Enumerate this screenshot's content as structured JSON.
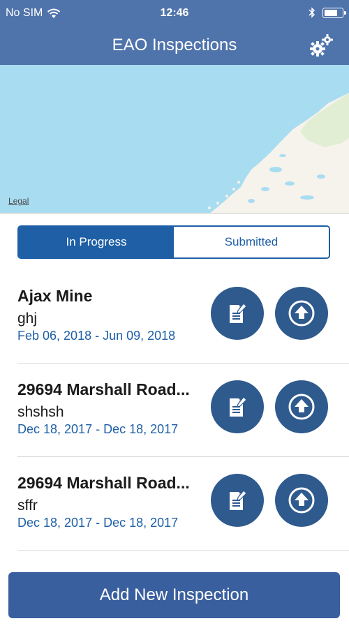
{
  "status_bar": {
    "carrier": "No SIM",
    "time": "12:46",
    "icons": [
      "wifi-icon",
      "bluetooth-icon",
      "battery-icon"
    ]
  },
  "nav": {
    "title": "EAO Inspections",
    "settings_icon": "gears-icon"
  },
  "map": {
    "legal_label": "Legal"
  },
  "tabs": [
    {
      "label": "In Progress",
      "selected": true
    },
    {
      "label": "Submitted",
      "selected": false
    }
  ],
  "inspections": [
    {
      "title": "Ajax Mine",
      "subtitle": "ghj",
      "dates": "Feb 06, 2018 - Jun 09, 2018"
    },
    {
      "title": "29694 Marshall Road...",
      "subtitle": "shshsh",
      "dates": "Dec 18, 2017 - Dec 18, 2017"
    },
    {
      "title": "29694 Marshall Road...",
      "subtitle": "sffr",
      "dates": "Dec 18, 2017 - Dec 18, 2017"
    }
  ],
  "add_button": {
    "label": "Add New Inspection"
  },
  "colors": {
    "header": "#4f73ab",
    "accent": "#1e5fa6",
    "circle_button": "#2e5a8e",
    "add_button": "#3a5f9e",
    "map_water": "#a8dcf1"
  }
}
